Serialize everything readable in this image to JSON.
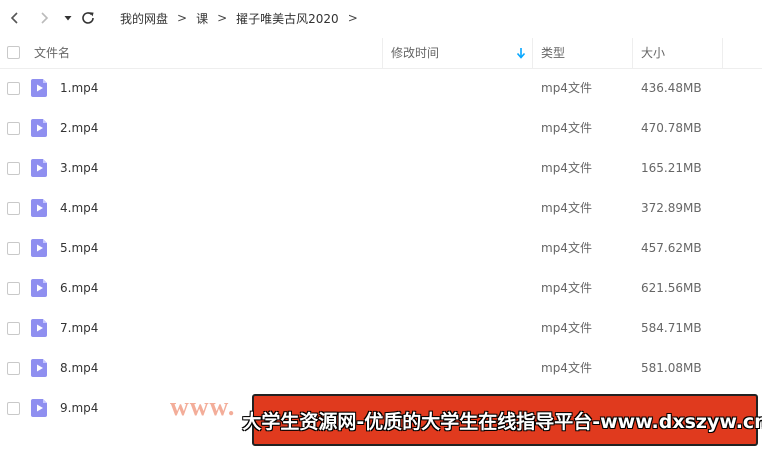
{
  "nav": {
    "breadcrumb": [
      "我的网盘",
      "课",
      "擢子唯美古风2020"
    ],
    "separator": ">"
  },
  "table": {
    "columns": {
      "name": "文件名",
      "modified": "修改时间",
      "type": "类型",
      "size": "大小"
    },
    "sort_column": "modified",
    "rows": [
      {
        "name": "1.mp4",
        "type": "mp4文件",
        "size": "436.48MB"
      },
      {
        "name": "2.mp4",
        "type": "mp4文件",
        "size": "470.78MB"
      },
      {
        "name": "3.mp4",
        "type": "mp4文件",
        "size": "165.21MB"
      },
      {
        "name": "4.mp4",
        "type": "mp4文件",
        "size": "372.89MB"
      },
      {
        "name": "5.mp4",
        "type": "mp4文件",
        "size": "457.62MB"
      },
      {
        "name": "6.mp4",
        "type": "mp4文件",
        "size": "621.56MB"
      },
      {
        "name": "7.mp4",
        "type": "mp4文件",
        "size": "584.71MB"
      },
      {
        "name": "8.mp4",
        "type": "mp4文件",
        "size": "581.08MB"
      },
      {
        "name": "9.mp4",
        "type": "",
        "size": ""
      }
    ]
  },
  "watermark": {
    "url_fragment": "www.",
    "banner": "大学生资源网-优质的大学生在线指导平台-www.dxszyw.cn"
  },
  "colors": {
    "file_icon": "#8f8ff0",
    "sort_accent": "#06a7ff",
    "banner_bg": "#e03a1e"
  },
  "icons": [
    "back-icon",
    "forward-icon",
    "dropdown-icon",
    "refresh-icon",
    "sort-down-icon",
    "video-file-icon"
  ]
}
